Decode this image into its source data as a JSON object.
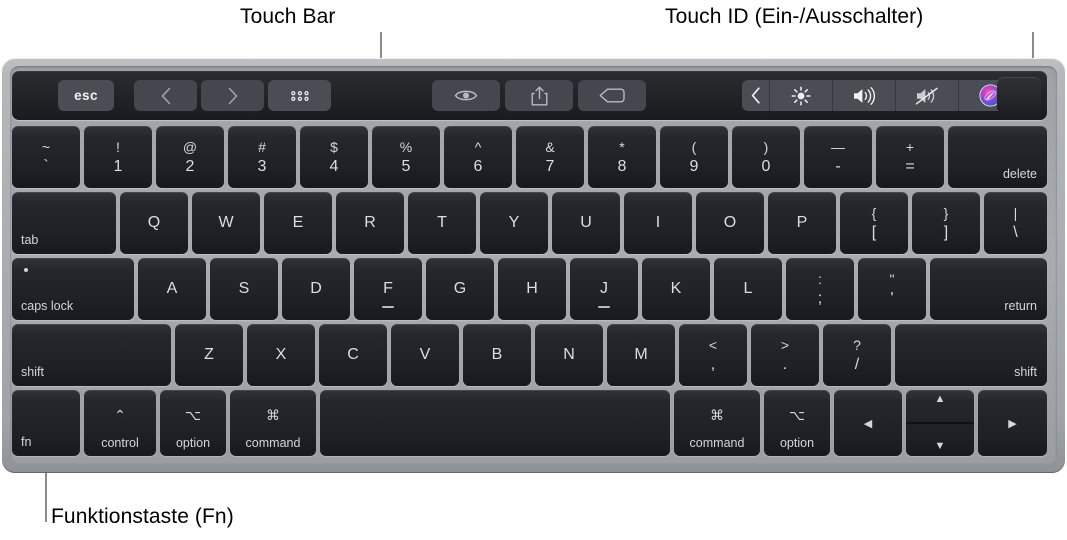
{
  "callouts": {
    "touch_bar": "Touch Bar",
    "touch_id": "Touch ID (Ein-/Ausschalter)",
    "fn": "Funktionstaste (Fn)"
  },
  "touch_bar": {
    "esc_label": "esc",
    "left_controls": [
      {
        "name": "back-chevron-icon",
        "icon": "chevron-left"
      },
      {
        "name": "forward-chevron-icon",
        "icon": "chevron-right"
      },
      {
        "name": "grid-view-icon",
        "icon": "grid-dots"
      }
    ],
    "center_controls": [
      {
        "name": "quick-look-icon",
        "icon": "eye"
      },
      {
        "name": "share-icon",
        "icon": "share"
      },
      {
        "name": "tag-icon",
        "icon": "tag"
      }
    ],
    "right_controls": [
      {
        "name": "expand-chevron-icon",
        "icon": "chevron-left"
      },
      {
        "name": "brightness-icon",
        "icon": "brightness"
      },
      {
        "name": "volume-up-icon",
        "icon": "volume"
      },
      {
        "name": "mute-icon",
        "icon": "mute"
      },
      {
        "name": "siri-icon",
        "icon": "siri"
      }
    ],
    "touch_id_name": "touch-id-button"
  },
  "keyboard": {
    "rows": [
      {
        "name": "number-row",
        "keys": [
          {
            "name": "key-backtick",
            "type": "dual",
            "top": "~",
            "bottom": "`"
          },
          {
            "name": "key-1",
            "type": "dual",
            "top": "!",
            "bottom": "1"
          },
          {
            "name": "key-2",
            "type": "dual",
            "top": "@",
            "bottom": "2"
          },
          {
            "name": "key-3",
            "type": "dual",
            "top": "#",
            "bottom": "3"
          },
          {
            "name": "key-4",
            "type": "dual",
            "top": "$",
            "bottom": "4"
          },
          {
            "name": "key-5",
            "type": "dual",
            "top": "%",
            "bottom": "5"
          },
          {
            "name": "key-6",
            "type": "dual",
            "top": "^",
            "bottom": "6"
          },
          {
            "name": "key-7",
            "type": "dual",
            "top": "&",
            "bottom": "7"
          },
          {
            "name": "key-8",
            "type": "dual",
            "top": "*",
            "bottom": "8"
          },
          {
            "name": "key-9",
            "type": "dual",
            "top": "(",
            "bottom": "9"
          },
          {
            "name": "key-0",
            "type": "dual",
            "top": ")",
            "bottom": "0"
          },
          {
            "name": "key-minus",
            "type": "dual",
            "top": "—",
            "bottom": "-"
          },
          {
            "name": "key-equals",
            "type": "dual",
            "top": "+",
            "bottom": "="
          },
          {
            "name": "key-delete",
            "type": "corner-right",
            "label": "delete"
          }
        ]
      },
      {
        "name": "qwerty-row",
        "keys": [
          {
            "name": "key-tab",
            "type": "corner-left",
            "label": "tab"
          },
          {
            "name": "key-q",
            "type": "letter",
            "label": "Q"
          },
          {
            "name": "key-w",
            "type": "letter",
            "label": "W"
          },
          {
            "name": "key-e",
            "type": "letter",
            "label": "E"
          },
          {
            "name": "key-r",
            "type": "letter",
            "label": "R"
          },
          {
            "name": "key-t",
            "type": "letter",
            "label": "T"
          },
          {
            "name": "key-y",
            "type": "letter",
            "label": "Y"
          },
          {
            "name": "key-u",
            "type": "letter",
            "label": "U"
          },
          {
            "name": "key-i",
            "type": "letter",
            "label": "I"
          },
          {
            "name": "key-o",
            "type": "letter",
            "label": "O"
          },
          {
            "name": "key-p",
            "type": "letter",
            "label": "P"
          },
          {
            "name": "key-bracket-left",
            "type": "dual",
            "top": "{",
            "bottom": "["
          },
          {
            "name": "key-bracket-right",
            "type": "dual",
            "top": "}",
            "bottom": "]"
          },
          {
            "name": "key-backslash",
            "type": "dual",
            "top": "|",
            "bottom": "\\"
          }
        ]
      },
      {
        "name": "home-row",
        "keys": [
          {
            "name": "key-caps-lock",
            "type": "caps",
            "label": "caps lock"
          },
          {
            "name": "key-a",
            "type": "letter",
            "label": "A"
          },
          {
            "name": "key-s",
            "type": "letter",
            "label": "S"
          },
          {
            "name": "key-d",
            "type": "letter",
            "label": "D"
          },
          {
            "name": "key-f",
            "type": "letter",
            "label": "F",
            "homing": true
          },
          {
            "name": "key-g",
            "type": "letter",
            "label": "G"
          },
          {
            "name": "key-h",
            "type": "letter",
            "label": "H"
          },
          {
            "name": "key-j",
            "type": "letter",
            "label": "J",
            "homing": true
          },
          {
            "name": "key-k",
            "type": "letter",
            "label": "K"
          },
          {
            "name": "key-l",
            "type": "letter",
            "label": "L"
          },
          {
            "name": "key-semicolon",
            "type": "dual",
            "top": ":",
            "bottom": ";"
          },
          {
            "name": "key-quote",
            "type": "dual",
            "top": "\"",
            "bottom": "'"
          },
          {
            "name": "key-return",
            "type": "corner-right",
            "label": "return"
          }
        ]
      },
      {
        "name": "shift-row",
        "keys": [
          {
            "name": "key-shift-left",
            "type": "corner-left",
            "label": "shift"
          },
          {
            "name": "key-z",
            "type": "letter",
            "label": "Z"
          },
          {
            "name": "key-x",
            "type": "letter",
            "label": "X"
          },
          {
            "name": "key-c",
            "type": "letter",
            "label": "C"
          },
          {
            "name": "key-v",
            "type": "letter",
            "label": "V"
          },
          {
            "name": "key-b",
            "type": "letter",
            "label": "B"
          },
          {
            "name": "key-n",
            "type": "letter",
            "label": "N"
          },
          {
            "name": "key-m",
            "type": "letter",
            "label": "M"
          },
          {
            "name": "key-comma",
            "type": "dual",
            "top": "<",
            "bottom": ","
          },
          {
            "name": "key-period",
            "type": "dual",
            "top": ">",
            "bottom": "."
          },
          {
            "name": "key-slash",
            "type": "dual",
            "top": "?",
            "bottom": "/"
          },
          {
            "name": "key-shift-right",
            "type": "corner-right",
            "label": "shift"
          }
        ]
      },
      {
        "name": "bottom-row",
        "keys": [
          {
            "name": "key-fn",
            "type": "corner-left",
            "label": "fn"
          },
          {
            "name": "key-control",
            "type": "modifier",
            "symbol": "⌃",
            "label": "control"
          },
          {
            "name": "key-option-left",
            "type": "modifier",
            "symbol": "⌥",
            "label": "option"
          },
          {
            "name": "key-command-left",
            "type": "modifier",
            "symbol": "⌘",
            "label": "command"
          },
          {
            "name": "key-space",
            "type": "blank",
            "label": ""
          },
          {
            "name": "key-command-right",
            "type": "modifier",
            "symbol": "⌘",
            "label": "command"
          },
          {
            "name": "key-option-right",
            "type": "modifier",
            "symbol": "⌥",
            "label": "option"
          },
          {
            "name": "key-arrow-left",
            "type": "arrow",
            "label": "◀"
          },
          {
            "name": "key-arrow-updown",
            "type": "arrow-updown",
            "up": "▲",
            "down": "▼"
          },
          {
            "name": "key-arrow-right",
            "type": "arrow",
            "label": "▶"
          }
        ]
      }
    ]
  },
  "colors": {
    "chassis": "#a8acb0",
    "key_face": "#22252a",
    "key_text": "#dcdee1",
    "touchbar_bg": "#1f2124",
    "touchbar_button": "#4a4d54",
    "callout_text": "#000000",
    "leader_line": "#8c8c8c"
  }
}
